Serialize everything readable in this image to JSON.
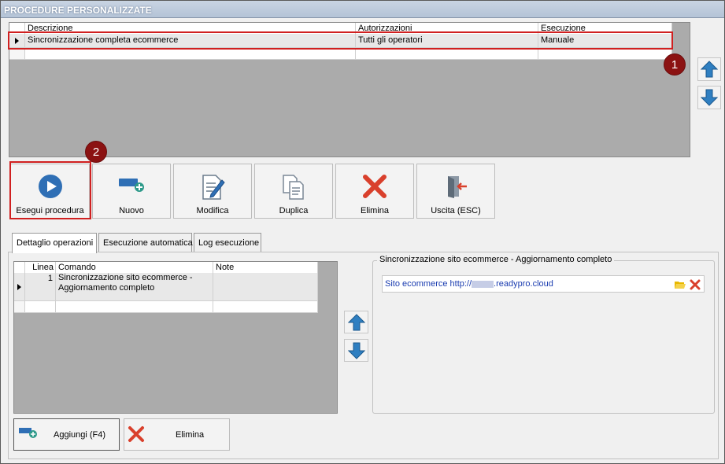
{
  "window": {
    "title": "PROCEDURE PERSONALIZZATE"
  },
  "procedures_grid": {
    "columns": [
      "Descrizione",
      "Autorizzazioni",
      "Esecuzione"
    ],
    "rows": [
      {
        "descrizione": "Sincronizzazione completa ecommerce",
        "autorizzazioni": "Tutti gli operatori",
        "esecuzione": "Manuale"
      }
    ]
  },
  "toolbar": {
    "run": "Esegui procedura",
    "new": "Nuovo",
    "edit": "Modifica",
    "duplicate": "Duplica",
    "delete": "Elimina",
    "exit": "Uscita (ESC)"
  },
  "badges": {
    "first": "1",
    "second": "2"
  },
  "tabs": [
    "Dettaglio operazioni",
    "Esecuzione automatica",
    "Log esecuzione"
  ],
  "operations_grid": {
    "columns": [
      "Linea",
      "Comando",
      "Note"
    ],
    "rows": [
      {
        "linea": "1",
        "comando_line1": "Sincronizzazione sito ecommerce -",
        "comando_line2": "Aggiornamento completo",
        "note": ""
      }
    ]
  },
  "params_group": {
    "title": "Sincronizzazione sito ecommerce - Aggiornamento completo",
    "value_prefix": "Sito ecommerce http://",
    "value_suffix": ".readypro.cloud"
  },
  "bottom_buttons": {
    "add": "Aggiungi (F4)",
    "delete": "Elimina"
  },
  "colors": {
    "accent_red": "#d02020",
    "badge": "#8b1212",
    "arrow_blue": "#2f7fc1"
  }
}
